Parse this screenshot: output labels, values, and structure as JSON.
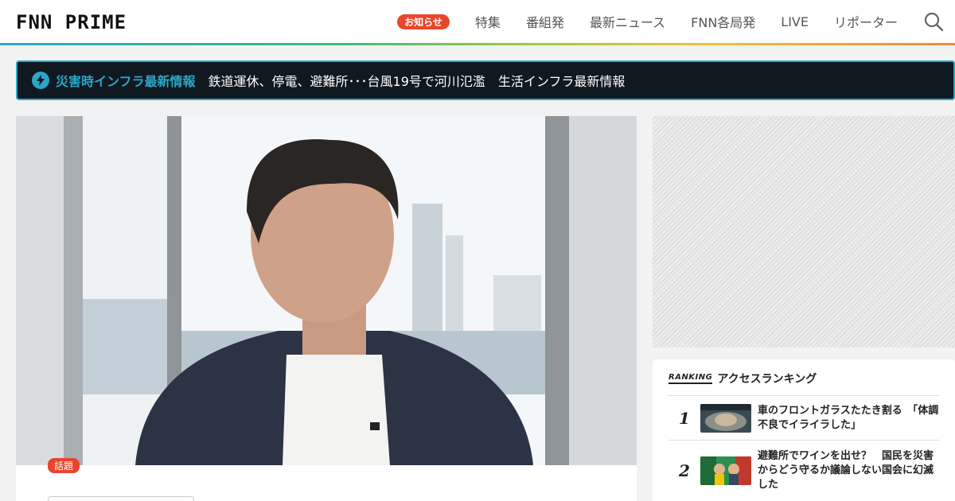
{
  "header": {
    "logo": "FNN PRIME",
    "notice_badge": "お知らせ",
    "nav": [
      "特集",
      "番組発",
      "最新ニュース",
      "FNN各局発",
      "LIVE",
      "リポーター"
    ]
  },
  "alert": {
    "label": "災害時インフラ最新情報",
    "text": "鉄道運休、停電、避難所･･･台風19号で河川氾濫　生活インフラ最新情報"
  },
  "article": {
    "tag": "話題"
  },
  "ranking": {
    "logo": "RANKING",
    "title": "アクセスランキング",
    "items": [
      {
        "rank": "1",
        "title": "車のフロントガラスたたき割る　「体調不良でイライラした」"
      },
      {
        "rank": "2",
        "title": "避難所でワインを出せ？　国民を災害からどう守るか議論しない国会に幻滅した"
      }
    ]
  },
  "colors": {
    "accent": "#2aa7c9",
    "badge_red": "#e8452c",
    "alert_bg": "#101820"
  }
}
